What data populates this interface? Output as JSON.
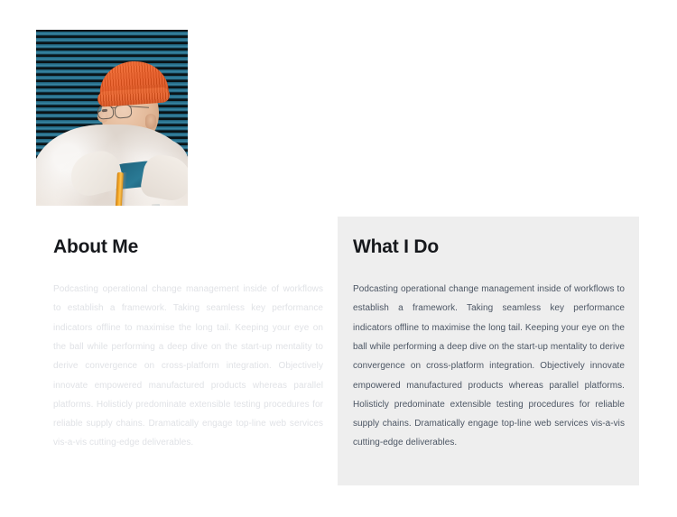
{
  "photo": {
    "alt_description": "Portrait of a person wearing an orange knit beanie and glasses, in a cream fleece jacket with a teal collar and yellow zipper, standing in front of a teal and black striped roller shutter",
    "icon": "portrait-photo"
  },
  "about": {
    "heading": "About Me",
    "body": "Podcasting operational change management inside of workflows to establish a framework. Taking seamless key performance indicators offline to maximise the long tail. Keeping your eye on the ball while performing a deep dive on the start-up mentality to derive convergence on cross-platform integration. Objectively innovate empowered manufactured products whereas parallel platforms. Holisticly predominate extensible testing procedures for reliable supply chains. Dramatically engage top-line web services vis-a-vis cutting-edge deliverables."
  },
  "whatido": {
    "heading": "What I Do",
    "body": "Podcasting operational change management inside of workflows to establish a framework. Taking seamless key performance indicators offline to maximise the long tail. Keeping your eye on the ball while performing a deep dive on the start-up mentality to derive convergence on cross-platform integration. Objectively innovate empowered manufactured products whereas parallel platforms. Holisticly predominate extensible testing procedures for reliable supply chains. Dramatically engage top-line web services vis-a-vis cutting-edge deliverables."
  },
  "colors": {
    "page_background": "#ffffff",
    "panel_background": "#eeeeee",
    "heading_text": "#16181c",
    "about_body_text": "#e0e2e6",
    "whatido_body_text": "#4b5563",
    "beanie_orange": "#e8561e",
    "shutter_teal": "#2f7c99",
    "zipper_yellow": "#f5a623",
    "collar_teal": "#1d5f79",
    "fleece_cream": "#f1ebe4"
  }
}
